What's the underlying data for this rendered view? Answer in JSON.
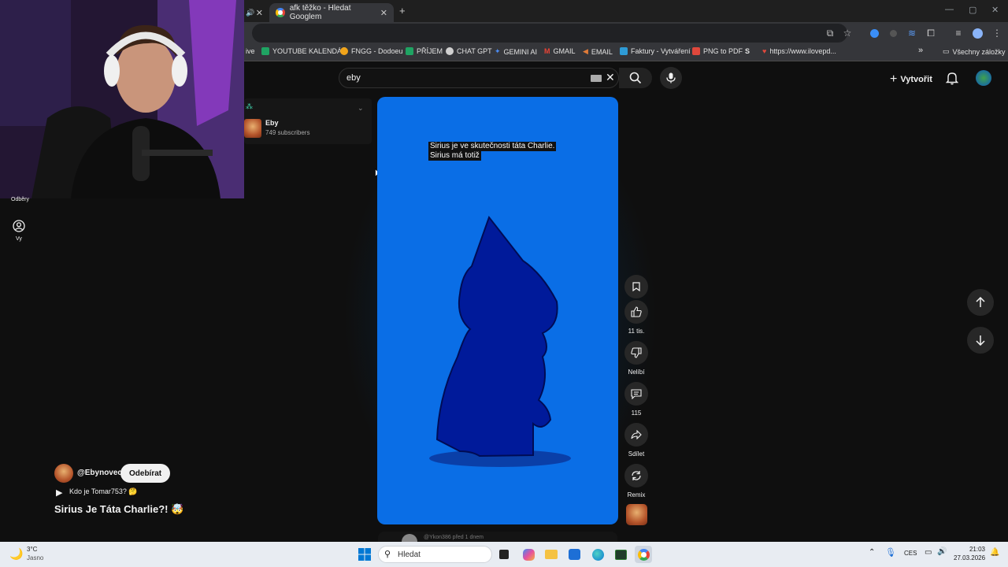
{
  "browser": {
    "tab_inactive_label": "",
    "tab_active_label": "afk těžko - Hledat Googlem",
    "bookmarks": [
      {
        "label": "ive",
        "color": "#4a4a4a"
      },
      {
        "label": "YOUTUBE KALENDÁŘ",
        "color": "#1fa463"
      },
      {
        "label": "FNGG - Dodoeu",
        "color": "#f0a41a"
      },
      {
        "label": "PŘÍJEM",
        "color": "#1fa463"
      },
      {
        "label": "CHAT GPT",
        "color": "#d0d0d0"
      },
      {
        "label": "GEMINI AI",
        "color": "#4c8df6"
      },
      {
        "label": "GMAIL",
        "color": "#ea4335"
      },
      {
        "label": "EMAIL",
        "color": "#e07b39"
      },
      {
        "label": "Faktury - Vytváření",
        "color": "#2e9bd6"
      },
      {
        "label": "PNG to PDF",
        "color": "#e0483c"
      },
      {
        "label": "",
        "color": "#ffffff"
      },
      {
        "label": "https://www.ilovepd...",
        "color": "#e0483c"
      }
    ],
    "all_bookmarks_label": "Všechny záložky",
    "more_bookmarks": "»"
  },
  "youtube": {
    "search_value": "eby",
    "create_label": "Vytvořit",
    "sidebar": {
      "subscriptions_label": "Odběry",
      "you_label": "Vy",
      "channel_name": "Eby",
      "channel_subs": "749 subscribers"
    },
    "short": {
      "caption_line1": "Sirius je ve skutečnosti táta Charlie.",
      "caption_line2": "Sirius má totiž",
      "likes": "11 tis.",
      "dislike_label": "Nelíbí",
      "comments": "115",
      "share_label": "Sdílet",
      "remix_label": "Remix",
      "channel_handle": "@Ebynovec",
      "subscribe_label": "Odebírat",
      "music_label": "Kdo je Tomar753? 🤔",
      "title": "Sirius Je Táta Charlie?! 🤯",
      "peek_comment": "@Ykon386 před 1 dnem"
    }
  },
  "taskbar": {
    "weather_temp": "3°C",
    "weather_desc": "Jasno",
    "search_placeholder": "Hledat",
    "language": "CES",
    "time": "21:03",
    "date": "27.03.2026"
  }
}
